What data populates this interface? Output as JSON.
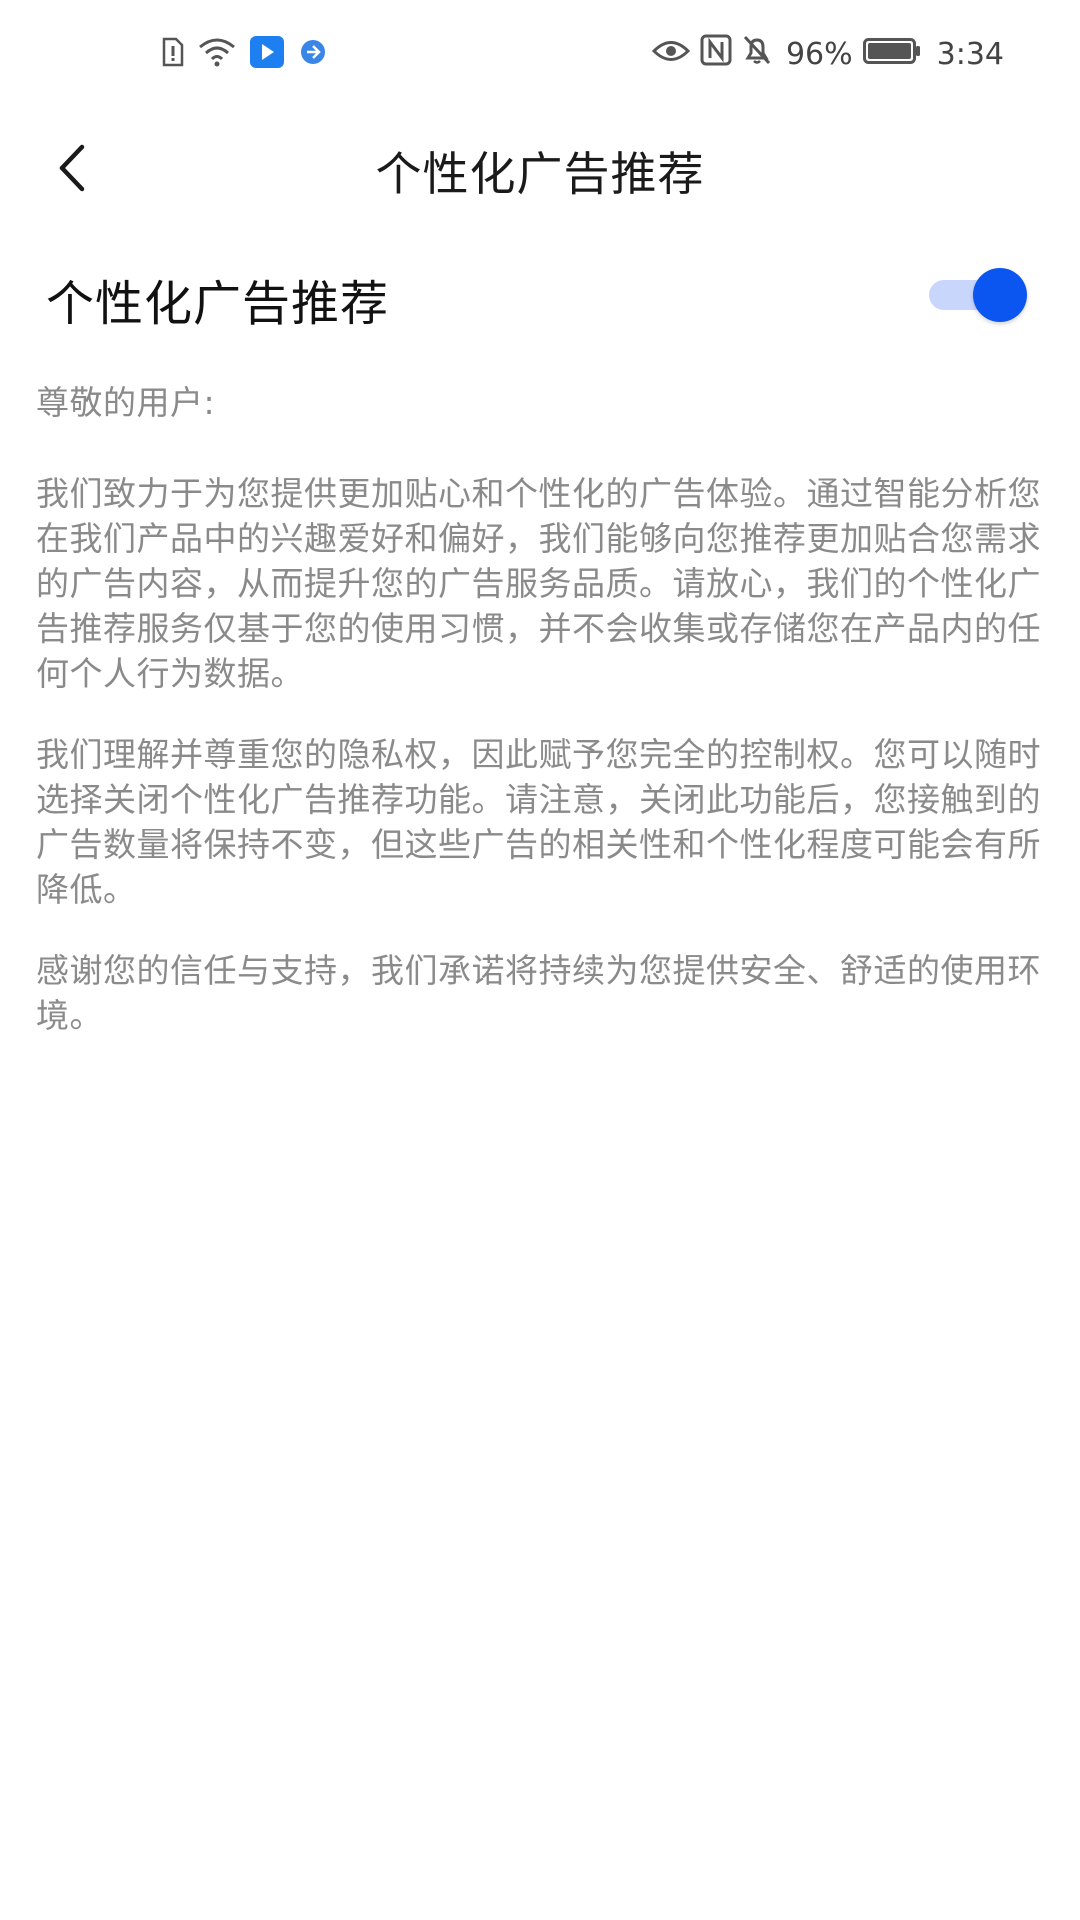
{
  "status_bar": {
    "left_icons": [
      "sim-alert-icon",
      "wifi-icon",
      "app-play-icon",
      "app-circle-icon"
    ],
    "right_icons": [
      "eye-icon",
      "nfc-icon",
      "mute-bell-icon",
      "battery-icon"
    ],
    "battery_percent": "96%",
    "time": "3:34",
    "colors": {
      "play_app": "#1e7ff0",
      "circle_app": "#3a86e8"
    }
  },
  "nav": {
    "back_icon": "chevron-left-icon",
    "title": "个性化广告推荐"
  },
  "setting": {
    "label": "个性化广告推荐",
    "toggle_on": true,
    "toggle_color": "#0b55f0",
    "toggle_track_color": "#c9d6fb"
  },
  "content": {
    "greeting": "尊敬的用户:",
    "paragraphs": [
      "我们致力于为您提供更加贴心和个性化的广告体验。通过智能分析您在我们产品中的兴趣爱好和偏好，我们能够向您推荐更加贴合您需求的广告内容，从而提升您的广告服务品质。请放心，我们的个性化广告推荐服务仅基于您的使用习惯，并不会收集或存储您在产品内的任何个人行为数据。",
      "我们理解并尊重您的隐私权，因此赋予您完全的控制权。您可以随时选择关闭个性化广告推荐功能。请注意，关闭此功能后，您接触到的广告数量将保持不变，但这些广告的相关性和个性化程度可能会有所降低。",
      "感谢您的信任与支持，我们承诺将持续为您提供安全、舒适的使用环境。"
    ]
  }
}
